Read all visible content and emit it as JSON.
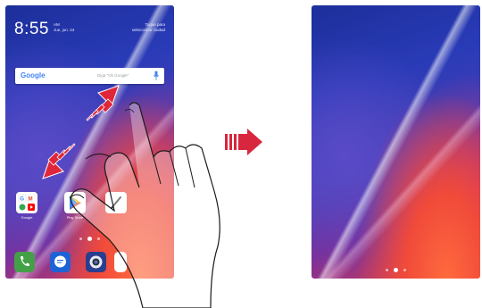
{
  "left_screen": {
    "clock": "8:55",
    "date_line1": "AM",
    "date_line2": "Jue, jun. 24",
    "weather_line1": "Toque para",
    "weather_line2": "seleccionar ciudad",
    "search": {
      "brand": "Google",
      "placeholder": "Diga \"Ok Google\"",
      "icon": "mic-icon"
    },
    "apps": [
      {
        "label": "Google",
        "icon": "google-folder-icon"
      },
      {
        "label": "Play Store",
        "icon": "play-store-icon"
      },
      {
        "label": "",
        "icon": "pen-icon"
      }
    ],
    "page_indicator": {
      "count": 3,
      "active_index": 1
    },
    "dock": [
      {
        "icon": "phone-icon",
        "color": "#43a047"
      },
      {
        "icon": "messages-icon",
        "color": "#1e63d6"
      },
      {
        "icon": "camera-icon",
        "color": "#2a3d8f"
      },
      {
        "icon": "browser-icon",
        "color": "#ffffff"
      }
    ]
  },
  "right_screen": {
    "page_indicator": {
      "count": 3,
      "active_index": 1
    }
  },
  "colors": {
    "gesture_arrow": "#e0263a",
    "transition_arrow": "#d7263d"
  }
}
